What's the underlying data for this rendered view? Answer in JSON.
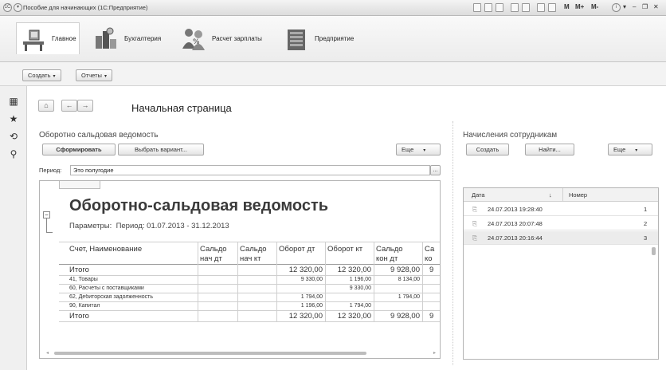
{
  "window": {
    "title": "Пособие для начинающих (1С:Предприятие)",
    "toolbar_labels": [
      "M",
      "M+",
      "M-"
    ]
  },
  "sections": [
    {
      "label": "Главное",
      "icon": "home-desk-icon",
      "active": true
    },
    {
      "label": "Бухгалтерия",
      "icon": "accounting-icon"
    },
    {
      "label": "Расчет зарплаты",
      "icon": "salary-people-icon"
    },
    {
      "label": "Предприятие",
      "icon": "enterprise-building-icon"
    }
  ],
  "commands": {
    "create": "Создать",
    "reports": "Отчеты"
  },
  "page": {
    "title": "Начальная страница"
  },
  "report_panel": {
    "title": "Оборотно сальдовая ведомость",
    "generate_button": "Сформировать",
    "variant_button": "Выбрать вариант...",
    "more_button": "Еще",
    "period_label": "Период:",
    "period_value": "Это полугодие",
    "period_select": "...",
    "report_title": "Оборотно-сальдовая ведомость",
    "params_label": "Параметры:",
    "params_value": "Период: 01.07.2013 - 31.12.2013",
    "columns": [
      {
        "line1": "Счет, Наименование",
        "line2": ""
      },
      {
        "line1": "Сальдо",
        "line2": "нач дт"
      },
      {
        "line1": "Сальдо",
        "line2": "нач кт"
      },
      {
        "line1": "Оборот дт",
        "line2": ""
      },
      {
        "line1": "Оборот кт",
        "line2": ""
      },
      {
        "line1": "Сальдо",
        "line2": "кон дт"
      },
      {
        "line1": "Са",
        "line2": "ко"
      }
    ],
    "rows": [
      {
        "name": "Итого",
        "snd": "",
        "snk": "",
        "od": "12 320,00",
        "ok": "12 320,00",
        "skd": "9 928,00",
        "skk": "9",
        "big": true
      },
      {
        "name": "41, Товары",
        "snd": "",
        "snk": "",
        "od": "9 330,00",
        "ok": "1 196,00",
        "skd": "8 134,00",
        "skk": "",
        "big": false
      },
      {
        "name": "60, Расчеты с поставщиками",
        "snd": "",
        "snk": "",
        "od": "",
        "ok": "9 330,00",
        "skd": "",
        "skk": "",
        "big": false
      },
      {
        "name": "62, Дебиторская задолженность",
        "snd": "",
        "snk": "",
        "od": "1 794,00",
        "ok": "",
        "skd": "1 794,00",
        "skk": "",
        "big": false
      },
      {
        "name": "90, Капитал",
        "snd": "",
        "snk": "",
        "od": "1 196,00",
        "ok": "1 794,00",
        "skd": "",
        "skk": "",
        "big": false
      },
      {
        "name": "Итого",
        "snd": "",
        "snk": "",
        "od": "12 320,00",
        "ok": "12 320,00",
        "skd": "9 928,00",
        "skk": "9",
        "big": true
      }
    ]
  },
  "accruals_panel": {
    "title": "Начисления сотрудникам",
    "create_button": "Создать",
    "find_button": "Найти...",
    "more_button": "Еще",
    "col_date": "Дата",
    "col_number": "Номер",
    "rows": [
      {
        "date": "24.07.2013 19:28:40",
        "number": "1"
      },
      {
        "date": "24.07.2013 20:07:48",
        "number": "2"
      },
      {
        "date": "24.07.2013 20:16:44",
        "number": "3"
      }
    ]
  }
}
